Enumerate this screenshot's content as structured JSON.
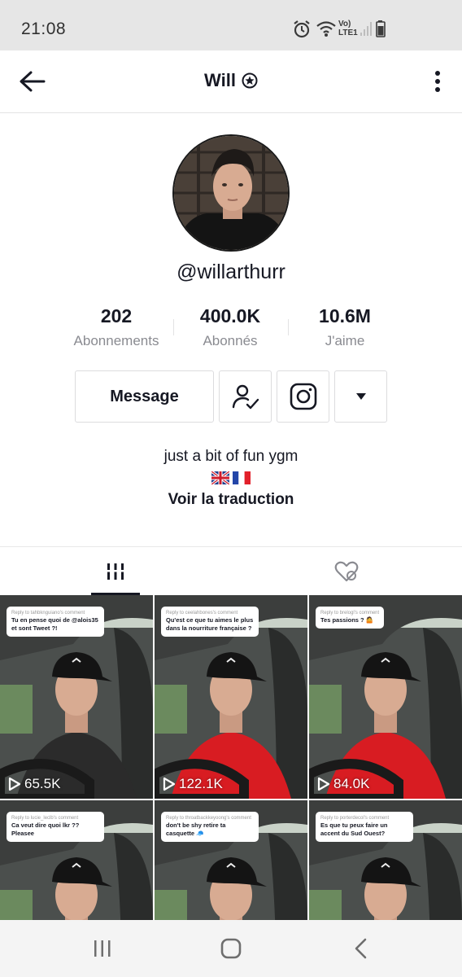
{
  "status_bar": {
    "time": "21:08",
    "network": "Vo) LTE1"
  },
  "header": {
    "title": "Will"
  },
  "profile": {
    "username": "@willarthurr",
    "stats": [
      {
        "value": "202",
        "label": "Abonnements"
      },
      {
        "value": "400.0K",
        "label": "Abonnés"
      },
      {
        "value": "10.6M",
        "label": "J'aime"
      }
    ],
    "message_label": "Message",
    "bio": "just a bit of fun ygm",
    "translate_label": "Voir la traduction"
  },
  "videos": [
    {
      "reply": "Reply to tahbknguiano's comment",
      "comment": "Tu en pense quoi de @alois35 et sont Tweet ?!",
      "views": "65.5K",
      "shirt": "#2b2b2b"
    },
    {
      "reply": "Reply to ceelahbones's comment",
      "comment": "Qu'est ce que tu aimes le plus dans la nourriture française ?",
      "views": "122.1K",
      "shirt": "#d81c22"
    },
    {
      "reply": "Reply to brelogl's comment",
      "comment": "Tes passions ? 🤷",
      "views": "84.0K",
      "shirt": "#d81c22"
    },
    {
      "reply": "Reply to lucie_leclb's comment",
      "comment": "Ca veut dire quoi lkr ?? Pleasee",
      "views": "",
      "shirt": "#2b2b2b"
    },
    {
      "reply": "Reply to throatbackkeyoong's comment",
      "comment": "don't be shy retire ta casquette 🧢",
      "views": "",
      "shirt": "#2b2b2b"
    },
    {
      "reply": "Reply to porterdecol's comment",
      "comment": "Es que tu peux faire un accent du Sud Ouest?",
      "views": "",
      "shirt": "#2b2b2b"
    }
  ],
  "colors": {
    "accent_text": "#161823",
    "muted_text": "#8a8b91",
    "border": "#dcdcde"
  }
}
